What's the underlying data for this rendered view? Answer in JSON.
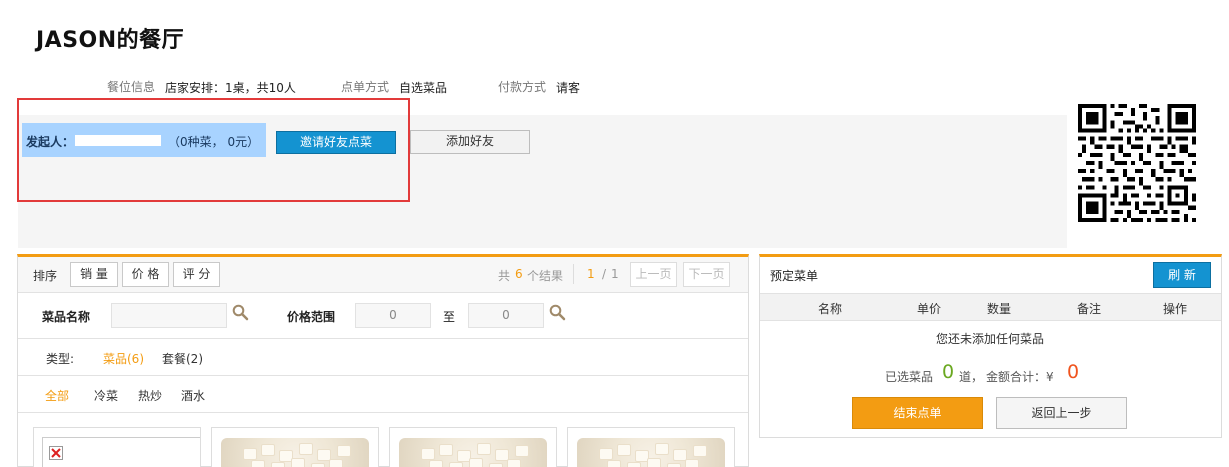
{
  "restaurant": {
    "title": "JASON的餐厅"
  },
  "info": {
    "seat_label": "餐位信息",
    "seat_value": "店家安排：1桌，共10人",
    "order_label": "点单方式",
    "order_value": "自选菜品",
    "pay_label": "付款方式",
    "pay_value": "请客"
  },
  "initiator": {
    "label": "发起人：",
    "summary": "（0种菜，  0元）",
    "invite_button": "邀请好友点菜",
    "add_friend_button": "添加好友"
  },
  "sort": {
    "label": "排序",
    "buttons": [
      "销 量",
      "价 格",
      "评 分"
    ]
  },
  "pager": {
    "total_prefix": "共",
    "total": "6",
    "total_suffix": "个结果",
    "current": "1",
    "separator": "/",
    "pages": "1",
    "prev": "上一页",
    "next": "下一页"
  },
  "filters": {
    "name_label": "菜品名称",
    "name_value": "",
    "price_label": "价格范围",
    "price_min": "0",
    "price_to": "至",
    "price_max": "0"
  },
  "types": {
    "label": "类型:",
    "items": [
      {
        "label": "菜品(6)",
        "active": true
      },
      {
        "label": "套餐(2)",
        "active": false
      }
    ]
  },
  "categories": {
    "items": [
      {
        "label": "全部",
        "active": true
      },
      {
        "label": "冷菜",
        "active": false
      },
      {
        "label": "热炒",
        "active": false
      },
      {
        "label": "酒水",
        "active": false
      }
    ]
  },
  "order": {
    "title": "预定菜单",
    "refresh_button": "刷 新",
    "columns": [
      "名称",
      "单价",
      "数量",
      "备注",
      "操作"
    ],
    "empty_text": "您还未添加任何菜品",
    "selected_prefix": "已选菜品",
    "selected_count": "0",
    "selected_unit": "道，",
    "total_label": "金额合计：¥",
    "total_value": "0",
    "finish_button": "结束点单",
    "back_button": "返回上一步"
  },
  "colors": {
    "accent_orange": "#f39c12",
    "highlight_red": "#e23a3a",
    "primary_blue": "#1493d1",
    "count_green": "#6aa820"
  },
  "icons": [
    "search-icon",
    "broken-image-icon",
    "qr-code"
  ]
}
